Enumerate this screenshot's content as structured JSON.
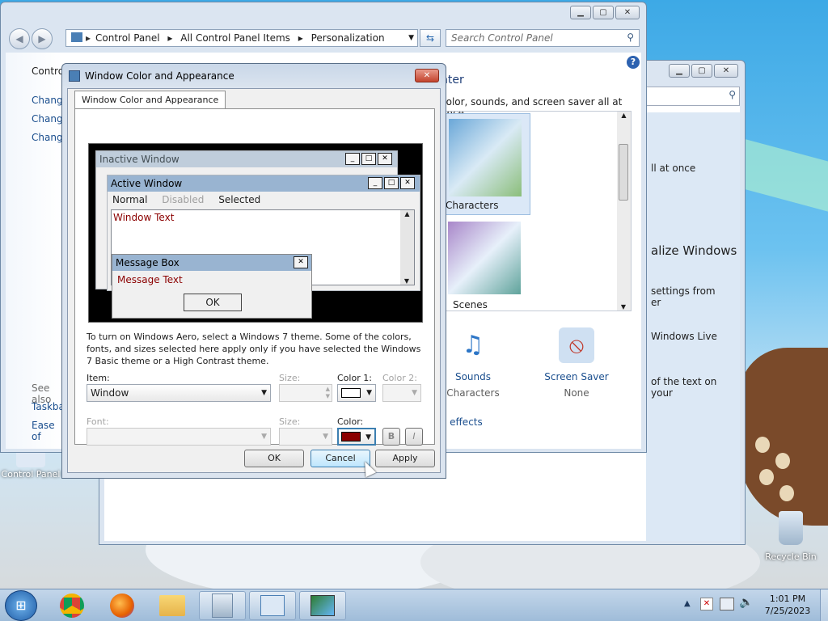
{
  "desktop": {
    "control_panel_icon_label": "Control Panel",
    "recycle_bin_label": "Recycle Bin"
  },
  "cp_window": {
    "breadcrumb": [
      "Control Panel",
      "All Control Panel Items",
      "Personalization"
    ],
    "search_placeholder": "Search Control Panel",
    "left_nav": {
      "home": "Control",
      "links": [
        "Change",
        "Change",
        "Change"
      ],
      "see_also_label": "See also",
      "see_also": [
        "Taskba",
        "Ease of"
      ]
    },
    "header_fragment": "nter",
    "subtitle_fragment": "color, sounds, and screen saver all at once.",
    "themes": [
      {
        "label": "Characters"
      },
      {
        "label": "Scenes"
      }
    ],
    "bottom_items": [
      {
        "label": "Sounds",
        "sub": "Characters"
      },
      {
        "label": "Screen Saver",
        "sub": "None"
      }
    ],
    "effects_link": "o effects"
  },
  "back_window": {
    "text1": "ll at once",
    "heading": "alize Windows",
    "text2a": "settings from",
    "text2b": "er",
    "text3": "Windows Live",
    "text4": "of the text on your"
  },
  "dialog": {
    "title": "Window Color and Appearance",
    "tab_label": "Window Color and Appearance",
    "preview": {
      "inactive_title": "Inactive Window",
      "active_title": "Active Window",
      "menu": [
        "Normal",
        "Disabled",
        "Selected"
      ],
      "window_text": "Window Text",
      "msgbox_title": "Message Box",
      "msgbox_text": "Message Text",
      "msgbox_ok": "OK"
    },
    "description": "To turn on Windows Aero, select a Windows 7 theme.  Some of the colors, fonts, and sizes selected here apply only if you have selected the Windows 7 Basic theme or a High Contrast theme.",
    "labels": {
      "item": "Item:",
      "size": "Size:",
      "color1": "Color 1:",
      "color2": "Color 2:",
      "font": "Font:",
      "font_size": "Size:",
      "color": "Color:",
      "bold": "B",
      "italic": "I"
    },
    "item_value": "Window",
    "color1_value": "#ffffff",
    "color_value": "#8b0000",
    "buttons": {
      "ok": "OK",
      "cancel": "Cancel",
      "apply": "Apply"
    }
  },
  "taskbar": {
    "time": "1:01 PM",
    "date": "7/25/2023"
  }
}
